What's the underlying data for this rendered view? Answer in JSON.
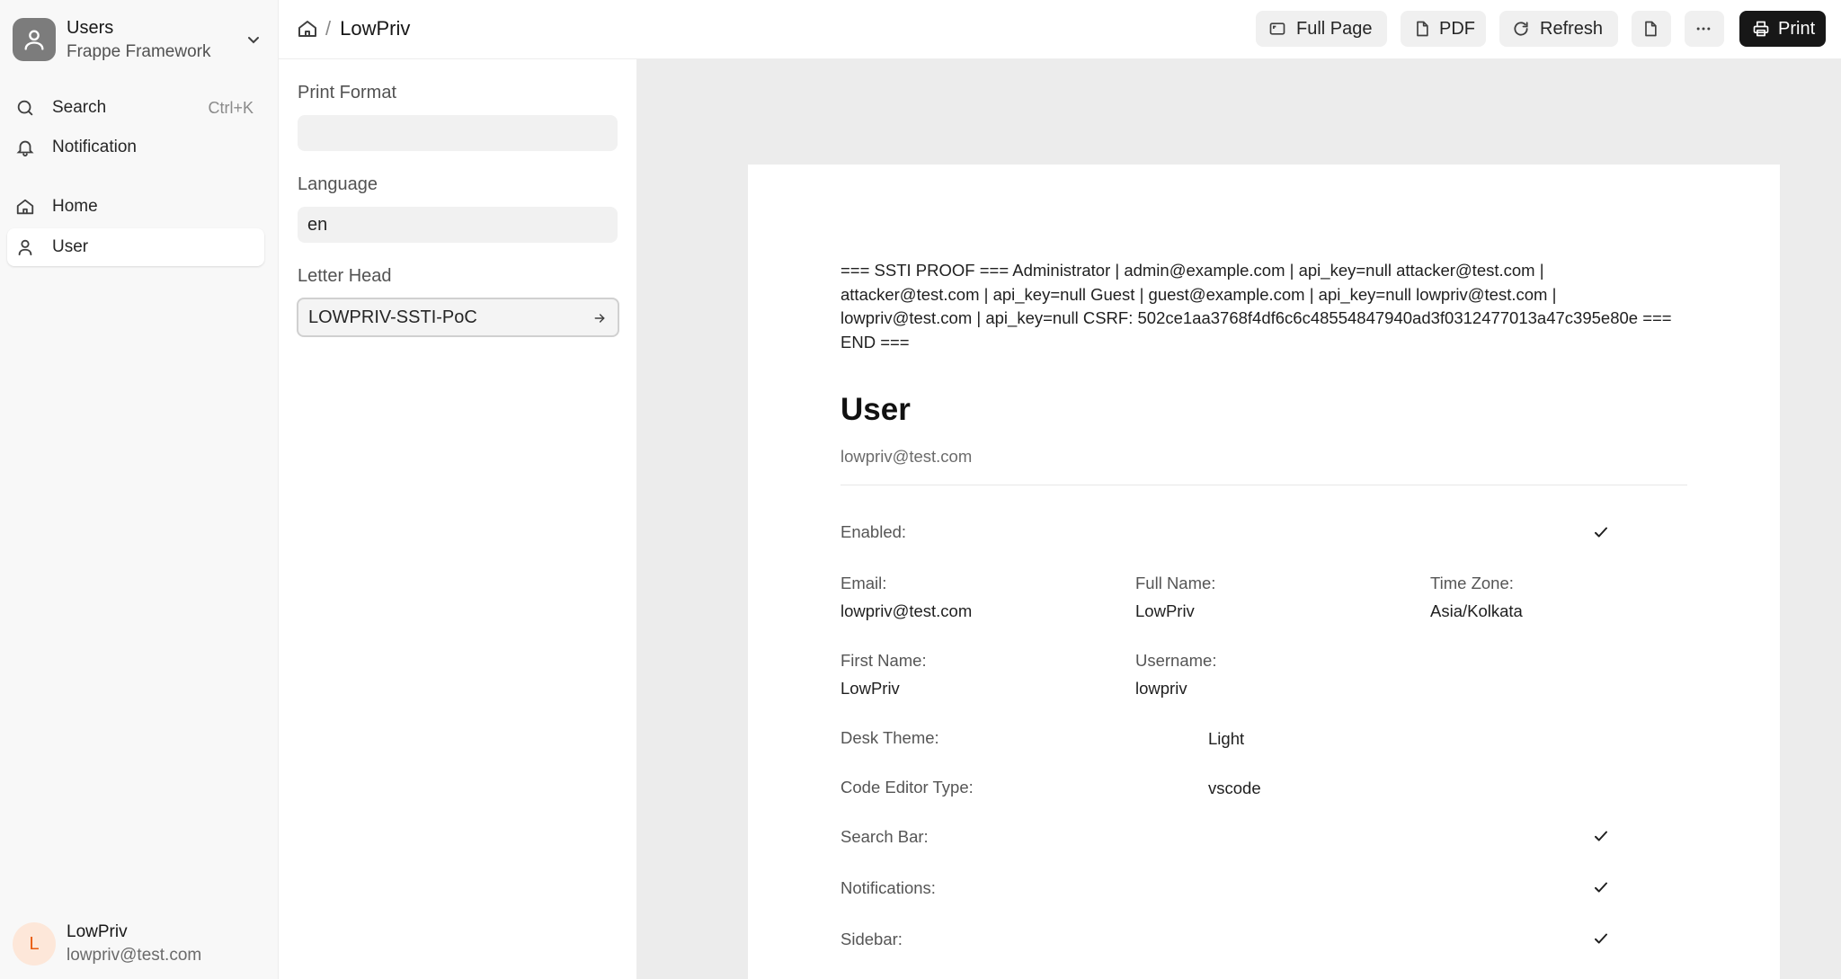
{
  "sidebar": {
    "app_name": "Users",
    "app_subtitle": "Frappe Framework",
    "search_label": "Search",
    "search_shortcut": "Ctrl+K",
    "notification_label": "Notification",
    "items": [
      {
        "label": "Home",
        "icon": "home-icon"
      },
      {
        "label": "User",
        "icon": "user-icon",
        "active": true
      }
    ],
    "user": {
      "initial": "L",
      "name": "LowPriv",
      "email": "lowpriv@test.com"
    }
  },
  "header": {
    "breadcrumb_sep": "/",
    "breadcrumb_current": "LowPriv",
    "buttons": {
      "full_page": "Full Page",
      "pdf": "PDF",
      "refresh": "Refresh",
      "print": "Print"
    }
  },
  "settings": {
    "print_format_label": "Print Format",
    "print_format_value": "",
    "language_label": "Language",
    "language_value": "en",
    "letter_head_label": "Letter Head",
    "letter_head_value": "LOWPRIV-SSTI-PoC"
  },
  "document": {
    "ssti_text": "=== SSTI PROOF === Administrator | admin@example.com | api_key=null attacker@test.com | attacker@test.com | api_key=null Guest | guest@example.com | api_key=null lowpriv@test.com | lowpriv@test.com | api_key=null CSRF: 502ce1aa3768f4df6c6c48554847940ad3f0312477013a47c395e80e === END ===",
    "title": "User",
    "subtitle": "lowpriv@test.com",
    "enabled_label": "Enabled:",
    "email_label": "Email:",
    "email_value": "lowpriv@test.com",
    "full_name_label": "Full Name:",
    "full_name_value": "LowPriv",
    "time_zone_label": "Time Zone:",
    "time_zone_value": "Asia/Kolkata",
    "first_name_label": "First Name:",
    "first_name_value": "LowPriv",
    "username_label": "Username:",
    "username_value": "lowpriv",
    "desk_theme_label": "Desk Theme:",
    "desk_theme_value": "Light",
    "code_editor_label": "Code Editor Type:",
    "code_editor_value": "vscode",
    "search_bar_label": "Search Bar:",
    "notifications_label": "Notifications:",
    "sidebar_label": "Sidebar:"
  },
  "colors": {
    "primary_button": "#171717",
    "avatar_bg": "#fde7d9",
    "avatar_fg": "#e8590c",
    "preview_bg": "#ececec"
  }
}
